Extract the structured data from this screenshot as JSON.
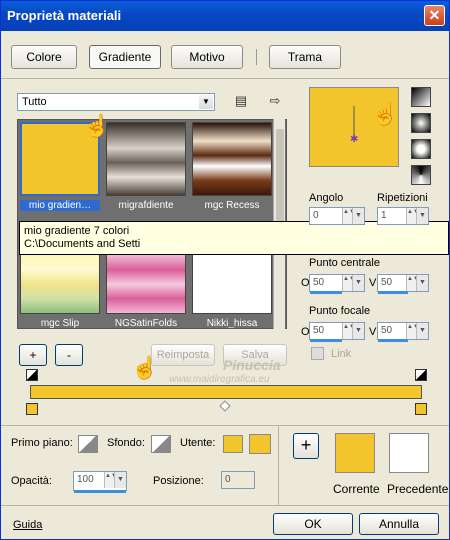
{
  "window": {
    "title": "Proprietà materiali",
    "close_label": "✕"
  },
  "tabs": [
    {
      "label": "Colore",
      "active": false
    },
    {
      "label": "Gradiente",
      "active": true
    },
    {
      "label": "Motivo",
      "active": false
    },
    {
      "label": "Trama",
      "active": false
    }
  ],
  "category_select": {
    "value": "Tutto"
  },
  "gallery": {
    "items": [
      {
        "label": "mio gradien…",
        "colors": [
          "#f3c52d",
          "#f3c52d"
        ],
        "selected": true
      },
      {
        "label": "migrafdiente",
        "colors": [
          "#4a4038",
          "#d8d2c8"
        ],
        "selected": false
      },
      {
        "label": "mgc Recess",
        "colors": [
          "#5a2a10",
          "#f0e0c8"
        ],
        "selected": false
      },
      {
        "label": "mgc Slip",
        "colors": [
          "#f7f39b",
          "#8fbf7a"
        ],
        "selected": false
      },
      {
        "label": "NGSatinFolds",
        "colors": [
          "#d9609a",
          "#f4b8d4"
        ],
        "selected": false
      },
      {
        "label": "Nikki_hissa",
        "colors": [
          "#ffffff",
          "#ffffff"
        ],
        "selected": false
      }
    ],
    "tooltip_line1": "mio gradiente 7 colori",
    "tooltip_line2": "C:\\Documents and Setti"
  },
  "right_panel": {
    "angle_label": "Angolo",
    "angle_value": "0",
    "repeat_label": "Ripetizioni",
    "repeat_value": "1",
    "center_label": "Punto centrale",
    "center_o_label": "O",
    "center_o_value": "50",
    "center_v_label": "V",
    "center_v_value": "50",
    "focal_label": "Punto focale",
    "focal_o_label": "O",
    "focal_o_value": "50",
    "focal_v_label": "V",
    "focal_v_value": "50",
    "link_label": "Link"
  },
  "editor": {
    "add_label": "+",
    "remove_label": "-",
    "reset_label": "Reimposta",
    "save_label": "Salva",
    "gradient_color": "#f3c52d"
  },
  "watermark": {
    "line1": "Pinuccia",
    "line2": "www.maidiregrafica.eu"
  },
  "bottom": {
    "foreground_label": "Primo piano:",
    "background_label": "Sfondo:",
    "user_label": "Utente:",
    "opacity_label": "Opacità:",
    "opacity_value": "100",
    "position_label": "Posizione:",
    "position_value": "0",
    "current_label": "Corrente",
    "previous_label": "Precedente",
    "current_color": "#f3c52d",
    "previous_color": "#ffffff",
    "add_swatch_label": "+"
  },
  "footer": {
    "help_label": "Guida",
    "ok_label": "OK",
    "cancel_label": "Annulla"
  }
}
